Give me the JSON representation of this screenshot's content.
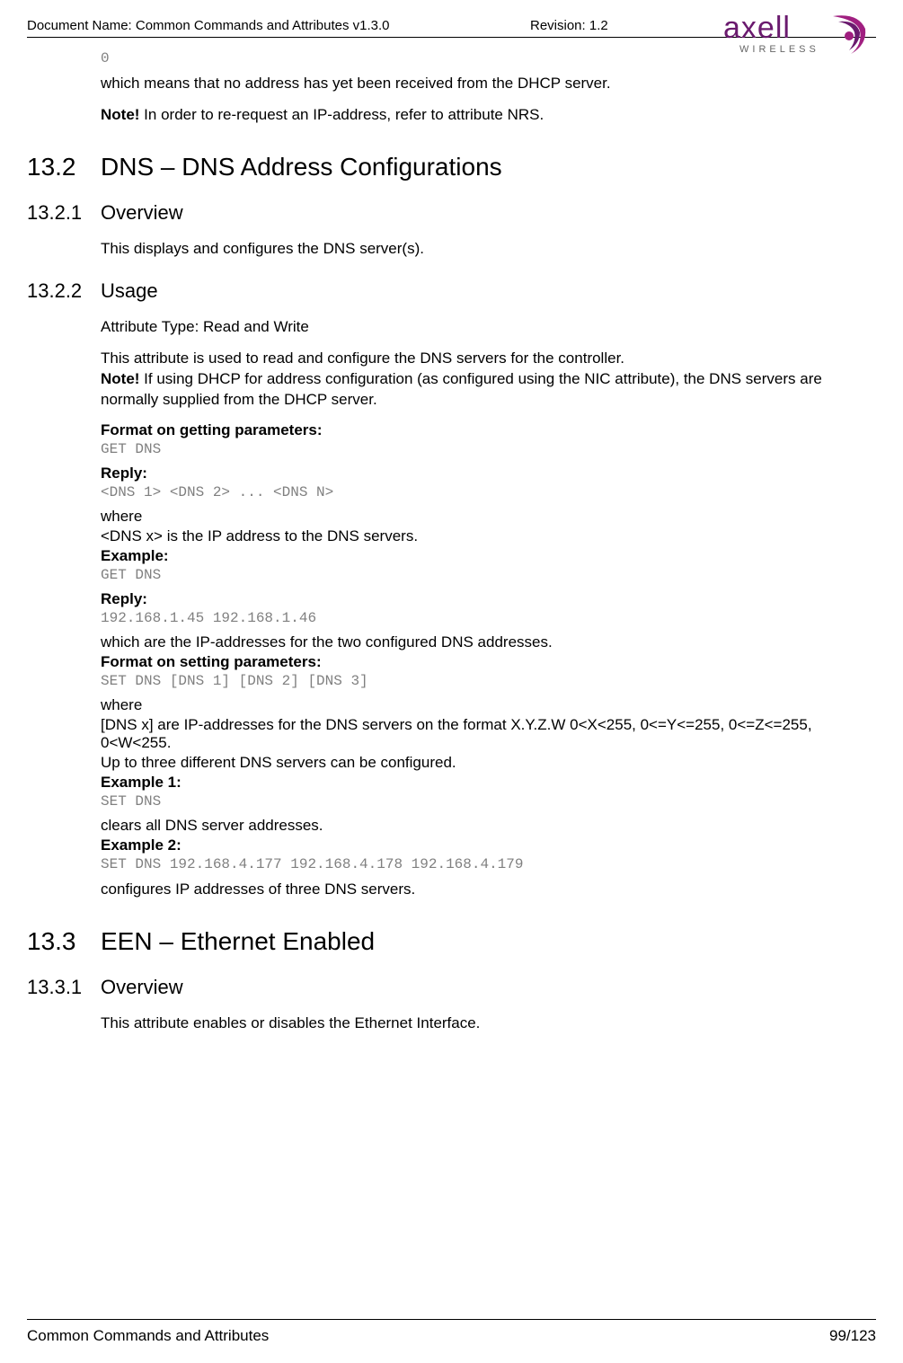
{
  "header": {
    "doc_name_label": "Document Name: Common Commands and Attributes v1.3.0",
    "revision_label": "Revision: 1.2",
    "logo_text": "axell",
    "logo_sub": "WIRELESS"
  },
  "intro": {
    "code": "0",
    "para": "which means that no address has yet been received from the DHCP server.",
    "note_label": "Note!",
    "note_text": " In order to re-request an IP-address, refer to attribute NRS."
  },
  "s132": {
    "num": "13.2",
    "title": "DNS – DNS Address Configurations"
  },
  "s1321": {
    "num": "13.2.1",
    "title": "Overview",
    "body": "This displays and configures the DNS server(s)."
  },
  "s1322": {
    "num": "13.2.2",
    "title": "Usage",
    "attr_type": "Attribute Type: Read and Write",
    "desc1": "This attribute is used to read and configure the DNS servers for the controller.",
    "note_label": "Note!",
    "note_text": " If using DHCP for address configuration (as configured using the NIC attribute), the DNS servers are normally supplied from the DHCP server.",
    "format_get_label": "Format on getting parameters:",
    "get_dns": "GET DNS",
    "reply_label1": "Reply:",
    "reply_code1": "<DNS 1> <DNS 2> ... <DNS N>",
    "where1": "where",
    "where1_desc": "<DNS x> is the IP address to the DNS servers.",
    "example_label": "Example:",
    "example_code": "GET DNS",
    "reply_label2": "Reply:",
    "reply_code2": "192.168.1.45 192.168.1.46",
    "reply_desc2": "which are the IP-addresses for the two configured DNS addresses.",
    "format_set_label": "Format on setting parameters:",
    "set_code": "SET DNS [DNS 1] [DNS 2] [DNS 3]",
    "where2": "where",
    "where2_desc1": "[DNS x] are IP-addresses for the DNS servers on the format X.Y.Z.W 0<X<255, 0<=Y<=255, 0<=Z<=255, 0<W<255.",
    "where2_desc2": "Up to three different DNS servers can be configured.",
    "ex1_label": "Example 1:",
    "ex1_code": "SET DNS",
    "ex1_desc": "clears all DNS server addresses.",
    "ex2_label": "Example 2:",
    "ex2_code": "SET DNS 192.168.4.177 192.168.4.178 192.168.4.179",
    "ex2_desc": "configures IP addresses of three DNS servers."
  },
  "s133": {
    "num": "13.3",
    "title": "EEN – Ethernet Enabled"
  },
  "s1331": {
    "num": "13.3.1",
    "title": "Overview",
    "body": "This attribute enables or disables the Ethernet Interface."
  },
  "footer": {
    "left": "Common Commands and Attributes",
    "right": "99/123"
  }
}
